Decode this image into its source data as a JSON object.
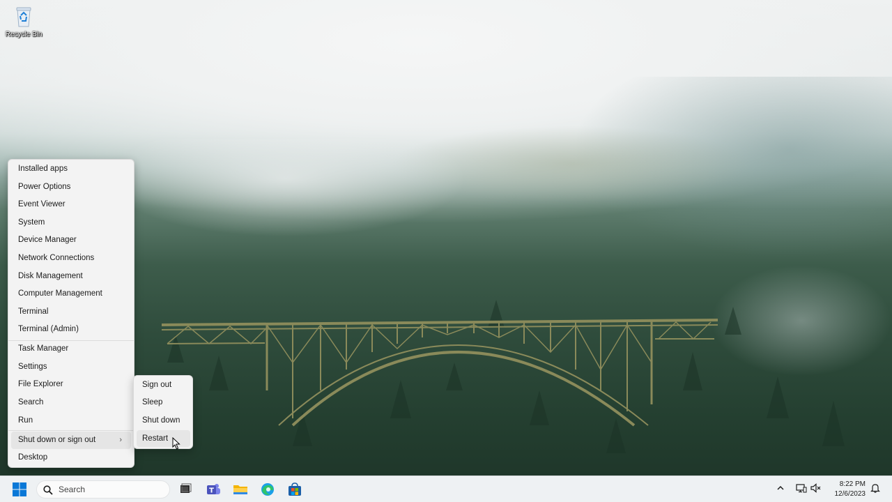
{
  "desktop": {
    "icons": [
      {
        "label": "Recycle Bin",
        "icon": "recycle-bin-icon"
      }
    ]
  },
  "context_menu": {
    "items": [
      {
        "label": "Installed apps"
      },
      {
        "label": "Power Options"
      },
      {
        "label": "Event Viewer"
      },
      {
        "label": "System"
      },
      {
        "label": "Device Manager"
      },
      {
        "label": "Network Connections"
      },
      {
        "label": "Disk Management"
      },
      {
        "label": "Computer Management"
      },
      {
        "label": "Terminal"
      },
      {
        "label": "Terminal (Admin)"
      },
      {
        "label": "Task Manager"
      },
      {
        "label": "Settings"
      },
      {
        "label": "File Explorer"
      },
      {
        "label": "Search"
      },
      {
        "label": "Run"
      },
      {
        "label": "Shut down or sign out",
        "has_submenu": true,
        "highlighted": true,
        "chevron": "›"
      },
      {
        "label": "Desktop"
      }
    ]
  },
  "power_submenu": {
    "items": [
      {
        "label": "Sign out"
      },
      {
        "label": "Sleep"
      },
      {
        "label": "Shut down"
      },
      {
        "label": "Restart",
        "highlighted": true
      }
    ]
  },
  "taskbar": {
    "start_icon": "windows-start-icon",
    "search": {
      "placeholder": "Search",
      "icon": "search-icon"
    },
    "pinned": [
      {
        "name": "task-view",
        "icon": "task-view-icon"
      },
      {
        "name": "teams",
        "icon": "teams-icon"
      },
      {
        "name": "file-explorer",
        "icon": "folder-icon"
      },
      {
        "name": "edge",
        "icon": "edge-icon"
      },
      {
        "name": "microsoft-store",
        "icon": "store-icon"
      }
    ],
    "tray": {
      "overflow_icon": "chevron-up-icon",
      "network_icon": "network-icon",
      "volume_icon": "volume-muted-icon",
      "notification_icon": "bell-icon",
      "time": "8:22 PM",
      "date": "12/6/2023"
    }
  },
  "colors": {
    "accent": "#0067c0",
    "menu_bg": "#f3f3f3",
    "taskbar_bg": "#eef1f3"
  }
}
